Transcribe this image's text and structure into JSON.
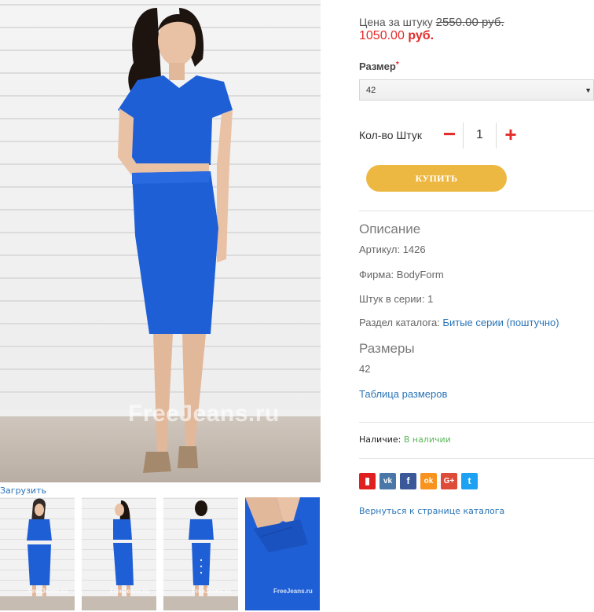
{
  "gallery": {
    "watermark": "FreeJeans.ru",
    "load_label": "Загрузить",
    "thumb_watermark": "FreeJeans.ru"
  },
  "price": {
    "label": "Цена за штуку",
    "old": "2550.00 руб.",
    "new_value": "1050.00",
    "currency": "руб."
  },
  "size": {
    "label": "Размер",
    "required_mark": "*",
    "selected": "42"
  },
  "quantity": {
    "label": "Кол-во Штук",
    "minus": "−",
    "value": "1",
    "plus": "+"
  },
  "buy_label": "КУПИТЬ",
  "description": {
    "title": "Описание",
    "article_label": "Артикул:",
    "article_value": "1426",
    "brand_label": "Фирма:",
    "brand_value": "BodyForm",
    "series_label": "Штук в серии:",
    "series_value": "1",
    "catalog_label": "Раздел каталога:",
    "catalog_link": "Битые серии (поштучно)"
  },
  "sizes": {
    "title": "Размеры",
    "list": "42",
    "table_link": "Таблица размеров"
  },
  "availability": {
    "label": "Наличие:",
    "value": "В наличии"
  },
  "social": [
    {
      "name": "bookmark-icon",
      "glyph": "▮",
      "color": "#e02020"
    },
    {
      "name": "vk-icon",
      "glyph": "vk",
      "color": "#4a76a8"
    },
    {
      "name": "facebook-icon",
      "glyph": "f",
      "color": "#3b5998"
    },
    {
      "name": "odnoklassniki-icon",
      "glyph": "ok",
      "color": "#f7931e"
    },
    {
      "name": "googleplus-icon",
      "glyph": "G+",
      "color": "#dd4b39"
    },
    {
      "name": "twitter-icon",
      "glyph": "t",
      "color": "#1da1f2"
    }
  ],
  "back_link": "Вернуться к странице каталога",
  "colors": {
    "accent_red": "#e32b2b",
    "buy_button": "#edb842",
    "link_blue": "#2a74b7",
    "in_stock_green": "#5cb85c",
    "dress_blue": "#1f5fd6"
  }
}
